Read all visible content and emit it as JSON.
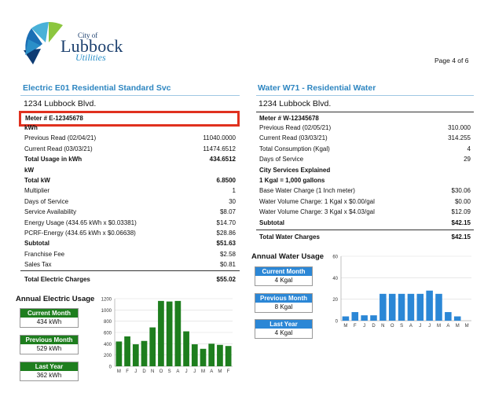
{
  "logo": {
    "city": "City of",
    "name": "Lubbock",
    "sub": "Utilities"
  },
  "page": "Page 4 of 6",
  "electric": {
    "title": "Electric E01 Residential Standard Svc",
    "address": "1234 Lubbock Blvd.",
    "meter": "Meter # E-12345678",
    "rows": [
      {
        "label": "kWh",
        "value": "",
        "bold": true
      },
      {
        "label": "Previous Read (02/04/21)",
        "value": "11040.0000",
        "bold": false
      },
      {
        "label": "Current Read (03/03/21)",
        "value": "11474.6512",
        "bold": false
      },
      {
        "label": "Total Usage in kWh",
        "value": "434.6512",
        "bold": true
      },
      {
        "label": "kW",
        "value": "",
        "bold": true
      },
      {
        "label": "Total kW",
        "value": "6.8500",
        "bold": true
      },
      {
        "label": "Multiplier",
        "value": "1",
        "bold": false
      },
      {
        "label": "Days of Service",
        "value": "30",
        "bold": false
      },
      {
        "label": "Service Availability",
        "value": "$8.07",
        "bold": false
      },
      {
        "label": "Energy Usage (434.65 kWh x $0.03381)",
        "value": "$14.70",
        "bold": false
      },
      {
        "label": "PCRF-Energy (434.65 kWh x $0.06638)",
        "value": "$28.86",
        "bold": false
      },
      {
        "label": "Subtotal",
        "value": "$51.63",
        "bold": true
      },
      {
        "label": "Franchise Fee",
        "value": "$2.58",
        "bold": false
      },
      {
        "label": "Sales Tax",
        "value": "$0.81",
        "bold": false
      }
    ],
    "total_label": "Total Electric Charges",
    "total_value": "$55.02",
    "usage_title": "Annual Electric Usage",
    "boxes": [
      {
        "label": "Current Month",
        "value": "434 kWh"
      },
      {
        "label": "Previous Month",
        "value": "529 kWh"
      },
      {
        "label": "Last Year",
        "value": "362 kWh"
      }
    ]
  },
  "water": {
    "title": "Water W71 - Residential Water",
    "address": "1234 Lubbock Blvd.",
    "meter": "Meter # W-12345678",
    "rows": [
      {
        "label": "Previous Read (02/05/21)",
        "value": "310.000",
        "bold": false
      },
      {
        "label": "Current Read (03/03/21)",
        "value": "314.255",
        "bold": false
      },
      {
        "label": "Total Consumption (Kgal)",
        "value": "4",
        "bold": false
      },
      {
        "label": "Days of Service",
        "value": "29",
        "bold": false
      },
      {
        "label": "City Services Explained",
        "value": "",
        "bold": true
      },
      {
        "label": "1 Kgal = 1,000 gallons",
        "value": "",
        "bold": true
      },
      {
        "label": "Base Water Charge  (1 Inch meter)",
        "value": "$30.06",
        "bold": false
      },
      {
        "label": "Water Volume Charge: 1 Kgal x $0.00/gal",
        "value": "$0.00",
        "bold": false
      },
      {
        "label": "Water Volume Charge: 3 Kgal x $4.03/gal",
        "value": "$12.09",
        "bold": false
      },
      {
        "label": "Subtotal",
        "value": "$42.15",
        "bold": true
      }
    ],
    "total_label": "Total Water Charges",
    "total_value": "$42.15",
    "usage_title": "Annual Water Usage",
    "boxes": [
      {
        "label": "Current Month",
        "value": "4 Kgal"
      },
      {
        "label": "Previous Month",
        "value": "8 Kgal"
      },
      {
        "label": "Last Year",
        "value": "4 Kgal"
      }
    ]
  },
  "chart_data": [
    {
      "type": "bar",
      "categories": [
        "M",
        "F",
        "J",
        "D",
        "N",
        "O",
        "S",
        "A",
        "J",
        "J",
        "M",
        "A",
        "M",
        "F"
      ],
      "values": [
        440,
        530,
        390,
        450,
        690,
        1160,
        1150,
        1160,
        620,
        390,
        310,
        400,
        380,
        360
      ],
      "ylim": [
        0,
        1200
      ],
      "yticks": [
        0,
        200,
        400,
        600,
        800,
        1000,
        1200
      ],
      "color": "#1e7e1e"
    },
    {
      "type": "bar",
      "categories": [
        "M",
        "F",
        "J",
        "D",
        "N",
        "O",
        "S",
        "A",
        "J",
        "J",
        "M",
        "A",
        "M",
        "M"
      ],
      "values": [
        4,
        8,
        5,
        5,
        25,
        25,
        25,
        25,
        25,
        28,
        25,
        8,
        4
      ],
      "ylim": [
        0,
        60
      ],
      "yticks": [
        0,
        20,
        40,
        60
      ],
      "color": "#2b87d6"
    }
  ]
}
